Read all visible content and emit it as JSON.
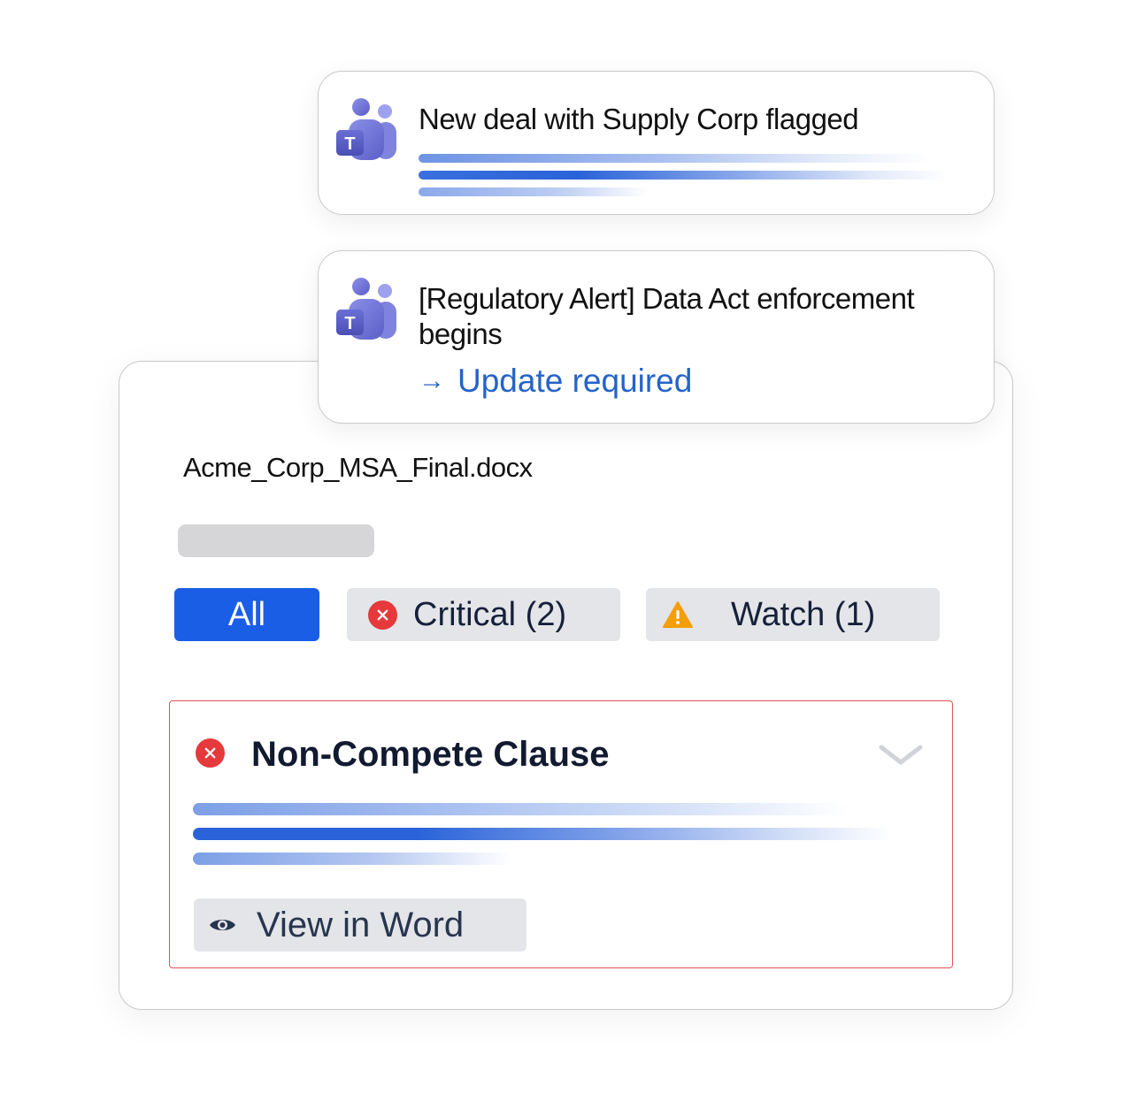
{
  "notifications": [
    {
      "title": "New deal with Supply Corp flagged",
      "icon": "teams-icon"
    },
    {
      "title": "[Regulatory Alert] Data Act enforcement begins",
      "icon": "teams-icon",
      "link_arrow": "→",
      "link_label": "Update required"
    }
  ],
  "document": {
    "filename": "Acme_Corp_MSA_Final.docx",
    "filters": {
      "all": "All",
      "critical": "Critical (2)",
      "watch": "Watch (1)"
    },
    "clause": {
      "title": "Non-Compete Clause",
      "status_icon": "critical-x-icon",
      "view_label": "View in Word"
    }
  },
  "colors": {
    "accent": "#1a5ee6",
    "critical": "#e5393b",
    "warning": "#f59e0b",
    "link": "#2563c8",
    "teams_purple": "#5b5fc7"
  }
}
